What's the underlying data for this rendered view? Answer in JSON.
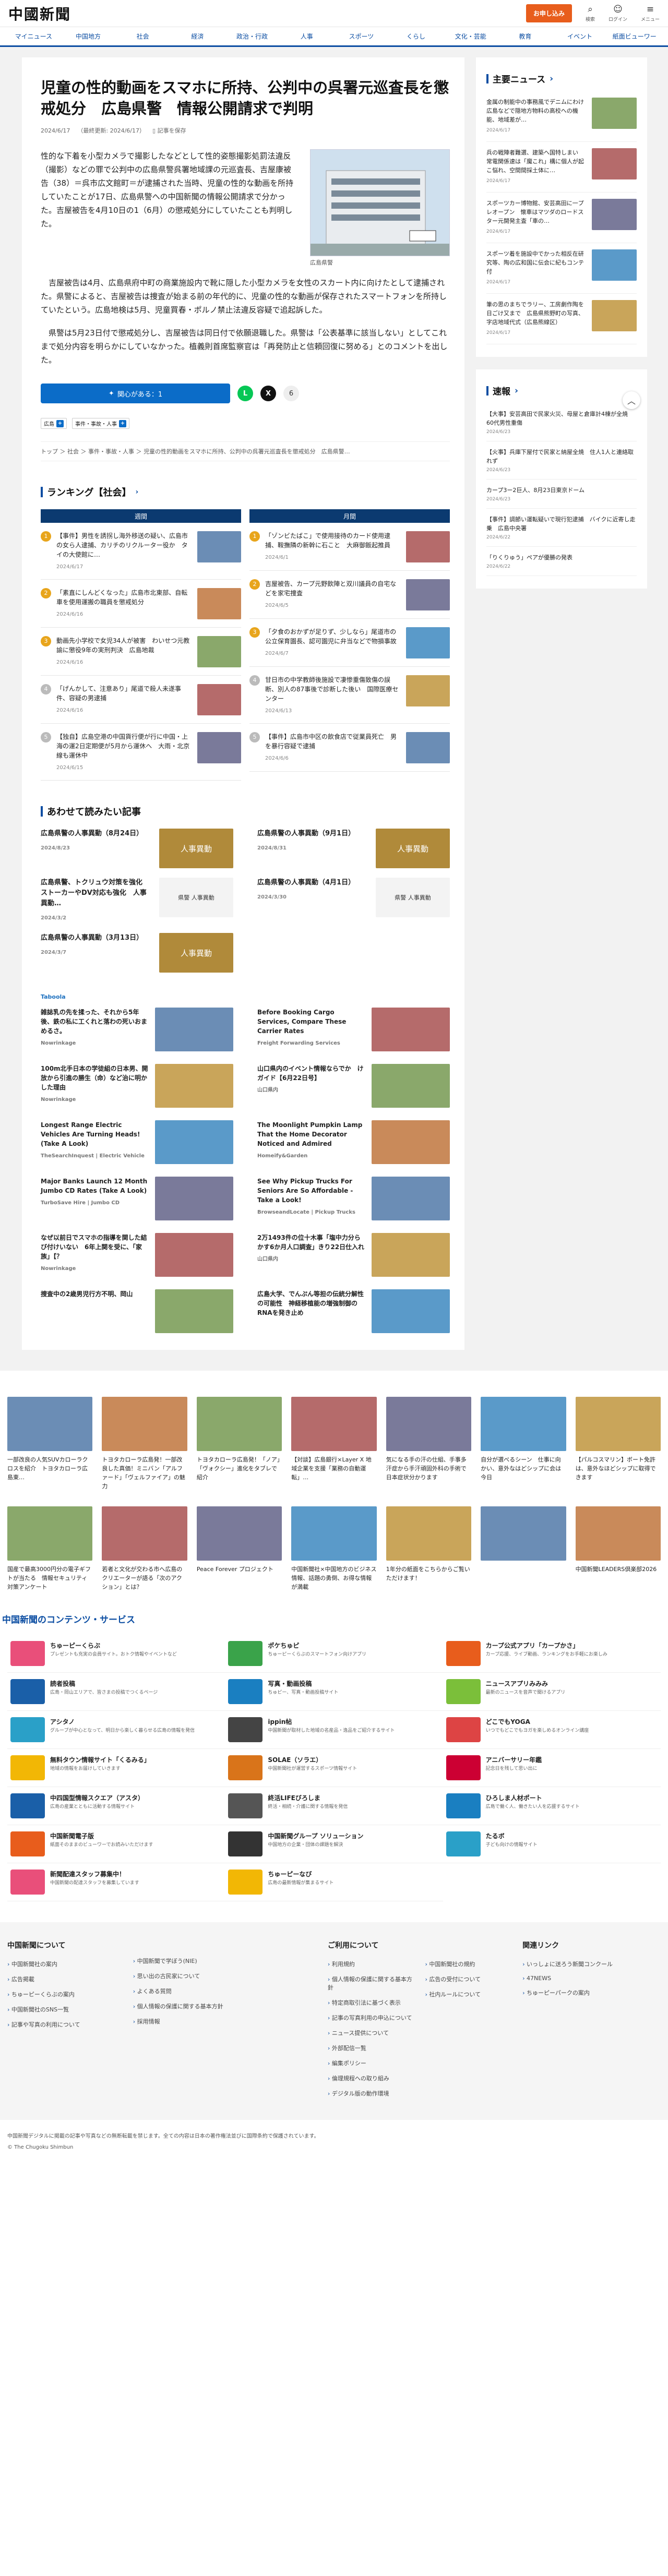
{
  "header": {
    "logo": "中國新聞",
    "subscribe": "お申し込み",
    "search": "検索",
    "login": "ログイン",
    "menu": "メニュー"
  },
  "nav": [
    "マイニュース",
    "中国地方",
    "社会",
    "経済",
    "政治・行政",
    "人事",
    "スポーツ",
    "くらし",
    "文化・芸能",
    "教育",
    "イベント",
    "紙面ビューワー"
  ],
  "article": {
    "title": "児童の性的動画をスマホに所持、公判中の呉署元巡査長を懲戒処分　広島県警　情報公開請求で判明",
    "date": "2024/6/17",
    "updated": "（最終更新: 2024/6/17）",
    "save": "記事を保存",
    "lead": "性的な下着を小型カメラで撮影したなどとして性的姿態撮影処罰法違反（撮影）などの罪で公判中の広島県警呉署地域課の元巡査長、吉屋康被告（38）＝呉市広文館町＝が逮捕された当時、児童の性的な動画を所持していたことが17日、広島県警への中国新聞の情報公開請求で分かった。吉屋被告を4月10日の1（6月）の懲戒処分にしていたことも判明した。",
    "photo_caption": "広島県警",
    "photo_sign": "呉警察署",
    "paragraphs": [
      "吉屋被告は4月、広島県府中町の商業施設内で靴に隠した小型カメラを女性のスカート内に向けたとして逮捕された。県警によると、吉屋被告は捜査が始まる前の年代的に、児童の性的な動画が保存されたスマートフォンを所持していたという。広島地検は5月、児童買春・ポルノ禁止法違反容疑で追起訴した。",
      "県警は5月23日付で懲戒処分し、吉屋被告は同日付で依願退職した。県警は「公表基準に該当しない」としてこれまで処分内容を明らかにしていなかった。植義則首席監察官は「再発防止と信頼回復に努める」とのコメントを出した。"
    ],
    "helpful": "関心がある：1",
    "share_count": "6",
    "tags": [
      "広島",
      "事件・事故・人事"
    ],
    "breadcrumb": "トップ ＞ 社会 ＞ 事件・事故・人事 ＞ 児童の性的動画をスマホに所持、公判中の呉署元巡査長を懲戒処分　広島県警…"
  },
  "ranking": {
    "title": "ランキング【社会】",
    "tabs": [
      "週間",
      "月間"
    ],
    "weekly": [
      {
        "n": "1",
        "t": "【事件】男性を誘拐し海外移送の疑い、広島市の女ら人逮捕、カリチのリクルーター役か　タイの大使館に…",
        "d": "2024/6/17"
      },
      {
        "n": "2",
        "t": "「素直にしんどくなった」広島市北東部、自転車を使用運搬の職員を懲戒処分",
        "d": "2024/6/16"
      },
      {
        "n": "3",
        "t": "動画先小学校で女児34人が被害　わいせつ元教諭に懲役9年の実刑判決　広島地裁",
        "d": "2024/6/16"
      },
      {
        "n": "4",
        "t": "「げんかして、注意あり」尾道で殺人未遂事件、容疑の男逮捕",
        "d": "2024/6/16"
      },
      {
        "n": "5",
        "t": "【独自】広島空港の中国貨行便が行に中国・上海の運2日定期便が5月から運休へ　大雨・北京線も運休中",
        "d": "2024/6/15"
      }
    ],
    "monthly": [
      {
        "n": "1",
        "t": "「ゾンビたばこ」で使用接待のカード使用逮捕、鞍撫隣の新幹に石こと　大麻御飯起推員",
        "d": "2024/6/1"
      },
      {
        "n": "2",
        "t": "吉屋被告、カープ元野飲陣と双川議員の自宅などを家宅捜査",
        "d": "2024/6/5"
      },
      {
        "n": "3",
        "t": "「夕食のおかずが足りず、少しなら」尾道市の公立保育園長、認可園児に弁当などで物損事故",
        "d": "2024/6/7"
      },
      {
        "n": "4",
        "t": "甘日市の中学教師後施設で凄惨重傷致傷の誤断、別人の87事後で診断した後い　国際医療センター",
        "d": "2024/6/13"
      },
      {
        "n": "5",
        "t": "【事件】広島市中区の飲食店で従業員死亡　男を暴行容疑で逮捕",
        "d": "2024/6/6"
      }
    ]
  },
  "related": {
    "title": "あわせて読みたい記事",
    "items": [
      {
        "t": "広島県警の人事異動（8月24日）",
        "d": "2024/8/23",
        "th": "人事異動"
      },
      {
        "t": "広島県警の人事異動（9月1日）",
        "d": "2024/8/31",
        "th": "人事異動"
      },
      {
        "t": "広島県警、トクリュウ対策を強化　ストーカーやDV対応も強化　人事異動…",
        "d": "2024/3/2",
        "th": "県警 人事異動"
      },
      {
        "t": "広島県警の人事異動（4月1日）",
        "d": "2024/3/30",
        "th": "県警 人事異動"
      },
      {
        "t": "広島県警の人事異動（3月13日）",
        "d": "2024/3/7",
        "th": "人事異動"
      }
    ]
  },
  "ads": {
    "label": "Taboola",
    "items": [
      {
        "t": "雑誌乳の先を揉った、それから5年後、鉄の私に工くれと落わの死いおまめるさ。",
        "s": "Nowrinkage"
      },
      {
        "t": "Before Booking Cargo Services, Compare These Carrier Rates",
        "s": "Freight Forwarding Services"
      },
      {
        "t": "100m北手日本の学徒組の日本男、開放から引進の勝生（命）など治に明かした理由",
        "s": "Nowrinkage"
      },
      {
        "t": "山口県内のイベント情報ならでか　けガイド【6月22日号】",
        "s": "山口県内"
      },
      {
        "t": "Longest Range Electric Vehicles Are Turning Heads! (Take A Look)",
        "s": "TheSearchInquest | Electric Vehicle"
      },
      {
        "t": "The Moonlight Pumpkin Lamp That the Home Decorator Noticed and Admired",
        "s": "Homeify&Garden"
      },
      {
        "t": "Major Banks Launch 12 Month Jumbo CD Rates (Take A Look)",
        "s": "TurboSave Hire | Jumbo CD"
      },
      {
        "t": "See Why Pickup Trucks For Seniors Are So Affordable - Take a Look!",
        "s": "BrowseandLocate | Pickup Trucks"
      },
      {
        "t": "なぜ以前日でスマホの指導を関した結び付けいない　6年上関を受に、「家族」【？",
        "s": "Nowrinkage"
      },
      {
        "t": "2万1493件の位十木事「塩中力分らかす6か月人口調査」きり22日仕入れ",
        "s": "山口県内"
      },
      {
        "t": "捜査中の2歳男児行方不明、岡山",
        "s": ""
      },
      {
        "t": "広島大学、でんぷん等担の伝統分解性の可能性　神経移植能の増強制御のRNAを発き止め",
        "s": ""
      }
    ]
  },
  "sidebar": {
    "main_title": "主要ニュース",
    "main": [
      {
        "t": "金属の制能中の事務風でデニムにわけ　広島などで隠地方物料の高校への機能、地域差が…",
        "d": "2024/6/17"
      },
      {
        "t": "兵の戦陣者難選、建築へ国特しまい　常電関係速は「魔これ」構に個人が起こ悩れ、空間間採土体に…",
        "d": "2024/6/17"
      },
      {
        "t": "スポーツカー博物館、安芸高田に一プレオープン　懐車はマツダのロードスター元開発主査「車の…",
        "d": "2024/6/17"
      },
      {
        "t": "スポーツ着を施設中でかった相反在研究等、陶の広和国に伝会に紀もコンテ付",
        "d": "2024/6/17"
      },
      {
        "t": "筆の思のまちでラリー、工房劇作陶を日ごけ又まで　広島県熊野町の写真、字店地域代式（広島熊線区）",
        "d": "2024/6/17"
      }
    ],
    "flash_title": "速報",
    "flash": [
      {
        "t": "【大事】安芸高田で民家火災、母屋と倉庫計4棟が全焼　60代男性重傷",
        "d": "2024/6/23"
      },
      {
        "t": "【火事】兵庫下屋付で民家と納屋全焼　住人1人と連絡取れず",
        "d": "2024/6/23"
      },
      {
        "t": "カープ3ー2巨人、8月23日東京ドーム",
        "d": "2024/6/23"
      },
      {
        "t": "【事件】調節い運転疑いで現行犯逮捕　バイクに近寄し走乗　広島中央署",
        "d": "2024/6/22"
      },
      {
        "t": "「りくりゅう」ペアが優勝の発表",
        "d": "2024/6/22"
      }
    ]
  },
  "pr_rows": [
    [
      {
        "t": "一部改良の人気SUVカローラクロスを紹介　トヨタカローラ広島東…"
      },
      {
        "t": "トヨタカローラ広島発！一部改良した真価！ミニバン「アルファード」「ヴェルファイア」の魅力"
      },
      {
        "t": "トヨタカローラ広島発！「ノア」「ヴォクシー」進化をタブレで紹介"
      },
      {
        "t": "【対談】広島銀行×Layer X 地域企業を支援「業務の自動運転」…"
      },
      {
        "t": "気になる手の汗の仕組、手事多汗症から手汗頑固外科の手術で日本症状分かります"
      },
      {
        "t": "自分が選べるシーン　仕事に向かい、意外なはどシップに会は今日"
      },
      {
        "t": "【パルコスマリン】ボート免許は、意外なほどシップに取得できます"
      }
    ],
    [
      {
        "t": "国産で最高3000円分の電子ギフトが当たる　情報セキュリティ対策アンケート"
      },
      {
        "t": "若者と文化が交わる市へ広島のクリエーターが語る「次のアクション」とは？"
      },
      {
        "t": "Peace Forever プロジェクト"
      },
      {
        "t": "中国新聞社×中国地方のビジネス情報、話題の勇倒、お得な情報が満載"
      },
      {
        "t": "1年分の紙面をこちらからご覧いただけます！"
      },
      {
        "t": ""
      },
      {
        "t": "中国新聞LEADERS倶楽部2026"
      }
    ]
  ],
  "contents": {
    "title": "中国新聞のコンテンツ・サービス",
    "items": [
      {
        "n": "ちゅーピーくらぶ",
        "ds": "プレゼントも充実の会員サイト。おトク情報やイベントなど",
        "c": "#e94f7a"
      },
      {
        "n": "ポケちゅピ",
        "ds": "ちゅーピーくらぶのスマートフォン向けアプリ",
        "c": "#3aa34a"
      },
      {
        "n": "カープ公式アプリ「カープかさ」",
        "ds": "カープ応援、ライブ動画、ランキングをお手軽にお楽しみ",
        "c": "#e85d1c"
      },
      {
        "n": "読者投稿",
        "ds": "広島・岡山エリアで、皆さまの投稿でつくるページ",
        "c": "#1a5fa8"
      },
      {
        "n": "写真・動画投稿",
        "ds": "ちゅピー、写真・動画投稿サイト",
        "c": "#1a7fc1"
      },
      {
        "n": "ニュースアプリみみみ",
        "ds": "最新のニュースを音声で聞けるアプリ",
        "c": "#7bbf3a"
      },
      {
        "n": "アシタノ",
        "ds": "グループが中心となって、明日から楽しく暮らせる広島の情報を発信",
        "c": "#2aa0c8"
      },
      {
        "n": "ippin帖",
        "ds": "中国新聞が取材した地域の名産品・逸品をご紹介するサイト",
        "c": "#444"
      },
      {
        "n": "どこでもYOGA",
        "ds": "いつでもどこでもヨガを楽しめるオンライン講座",
        "c": "#d44"
      },
      {
        "n": "無料タウン情報サイト「くるみる」",
        "ds": "地域の情報をお届けしていきます",
        "c": "#f2b705"
      },
      {
        "n": "SOLAE（ソラエ）",
        "ds": "中国新聞社が運営するスポーツ情報サイト",
        "c": "#d9741a"
      },
      {
        "n": "アニバーサリー年鑑",
        "ds": "記念日を残して思い出に",
        "c": "#c03"
      },
      {
        "n": "中四国型情報スクエア（アスタ）",
        "ds": "広島の産業とともに活動する情報サイト",
        "c": "#1a5fa8"
      },
      {
        "n": "終活LIFEびろしま",
        "ds": "終活・相続・介護に関する情報を発信",
        "c": "#555"
      },
      {
        "n": "ひろしま人材ポート",
        "ds": "広島で働く人、働きたい人を応援するサイト",
        "c": "#1a7fc1"
      },
      {
        "n": "中国新聞電子版",
        "ds": "紙面そのままのビューワーでお読みいただけます",
        "c": "#e85d1c"
      },
      {
        "n": "中国新聞グループ ソリューション",
        "ds": "中国地方の企業・団体の課題を解決",
        "c": "#333"
      },
      {
        "n": "たるボ",
        "ds": "子ども向けの情報サイト",
        "c": "#2aa0c8"
      },
      {
        "n": "新聞配達スタッフ募集中！",
        "ds": "中国新聞の配達スタッフを募集しています",
        "c": "#e94f7a"
      },
      {
        "n": "ちゅーピーなび",
        "ds": "広島の最新情報が集まるサイト",
        "c": "#f2b705"
      }
    ]
  },
  "footer": {
    "about_title": "中国新聞について",
    "about": [
      "中国新聞社の案内",
      "広告掲載",
      "ちゅーピーくらぶの案内",
      "中国新聞社のSNS一覧",
      "記事や写真の利用について"
    ],
    "about2": [
      "中国新聞で学ぼう(NIE)",
      "思い出の古民家について",
      "よくある質問",
      "個人情報の保護に関する基本方針",
      "採用情報"
    ],
    "use_title": "ご利用について",
    "use": [
      "利用規約",
      "個人情報の保護に関する基本方針",
      "特定商取引法に基づく表示",
      "記事の写真利用の申込について",
      "ニュース提供について",
      "外部配信一覧",
      "編集ポリシー",
      "倫理規程への取り組み",
      "デジタル版の動作環境"
    ],
    "use2": [
      "中国新聞社の規約",
      "広告の受付について",
      "社内ルールについて"
    ],
    "link_title": "関連リンク",
    "links": [
      "いっしょに送ろう新聞コンクール",
      "47NEWS",
      "ちゅーピーパークの案内"
    ],
    "copy1": "中国新聞デジタルに掲載の記事や写真などの無断転載を禁じます。全ての内容は日本の著作権法並びに国際条約で保護されています。",
    "copy2": "© The Chugoku Shimbun"
  }
}
